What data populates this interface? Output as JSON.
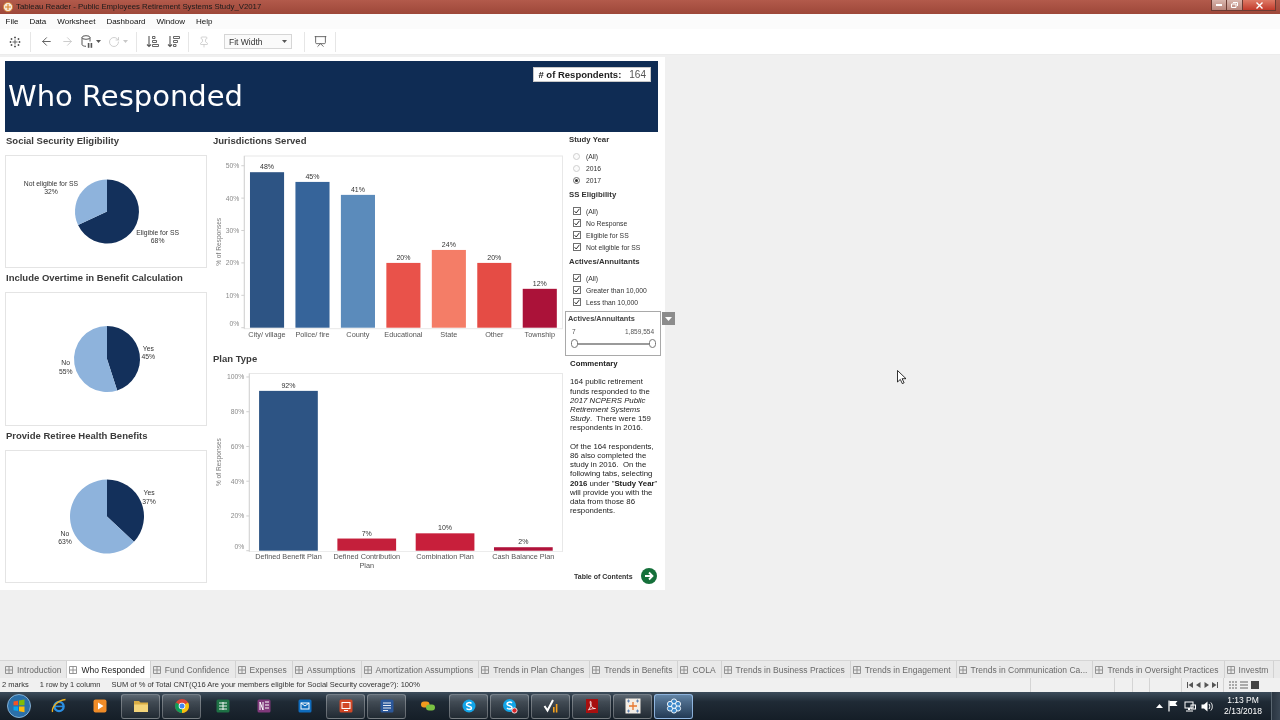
{
  "window": {
    "title": "Tableau Reader - Public Employees Retirement Systems Study_V2017"
  },
  "menu": [
    "File",
    "Data",
    "Worksheet",
    "Dashboard",
    "Window",
    "Help"
  ],
  "toolbar": {
    "groups": [
      {
        "items": [
          {
            "kind": "button",
            "disabled": false
          }
        ]
      },
      {
        "items": [
          {
            "kind": "button",
            "disabled": false
          },
          {
            "kind": "button",
            "disabled": true
          },
          {
            "kind": "button",
            "disabled": false
          },
          {
            "kind": "button",
            "disabled": true
          }
        ]
      },
      {
        "items": [
          {
            "kind": "button",
            "disabled": false
          },
          {
            "kind": "button",
            "disabled": false
          }
        ]
      },
      {
        "items": [
          {
            "kind": "button",
            "disabled": true
          },
          {
            "kind": "select",
            "value": "Fit Width"
          }
        ]
      },
      {
        "items": [
          {
            "kind": "button",
            "disabled": false
          }
        ]
      }
    ]
  },
  "dashboard": {
    "title": "Who Responded",
    "respondents": {
      "label": "# of Respondents:",
      "value": "164"
    },
    "pies": [
      {
        "title": "Social Security Eligibility",
        "chart_data": {
          "type": "pie",
          "categories": [
            "Eligible for SS",
            "Not eligible for SS"
          ],
          "values": [
            68,
            32
          ],
          "colors": [
            "#13305b",
            "#8eb3dc"
          ],
          "value_labels": [
            "68%",
            "32%"
          ]
        }
      },
      {
        "title": "Include Overtime in Benefit Calculation",
        "chart_data": {
          "type": "pie",
          "categories": [
            "Yes",
            "No"
          ],
          "values": [
            45,
            55
          ],
          "colors": [
            "#13305b",
            "#8eb3dc"
          ],
          "value_labels": [
            "45%",
            "55%"
          ]
        }
      },
      {
        "title": "Provide Retiree Health Benefits",
        "chart_data": {
          "type": "pie",
          "categories": [
            "Yes",
            "No"
          ],
          "values": [
            37,
            63
          ],
          "colors": [
            "#13305b",
            "#8eb3dc"
          ],
          "value_labels": [
            "37%",
            "63%"
          ]
        }
      }
    ],
    "jurisdictions": {
      "title": "Jurisdictions Served",
      "chart_data": {
        "type": "bar",
        "ylabel": "% of Responses",
        "categories": [
          "City/ village",
          "Police/ fire",
          "County",
          "Educational",
          "State",
          "Other",
          "Township"
        ],
        "values": [
          48,
          45,
          41,
          20,
          24,
          20,
          12
        ],
        "colors": [
          "#2d5484",
          "#36649a",
          "#5b8bbb",
          "#e9524a",
          "#f47d67",
          "#e54c45",
          "#ab1239"
        ],
        "ylim": [
          0,
          53
        ],
        "yticks": [
          {
            "value": 0,
            "label": "0%"
          },
          {
            "value": 10,
            "label": "10%"
          },
          {
            "value": 20,
            "label": "20%"
          },
          {
            "value": 30,
            "label": "30%"
          },
          {
            "value": 40,
            "label": "40%"
          },
          {
            "value": 50,
            "label": "50%"
          }
        ],
        "value_labels": [
          "48%",
          "45%",
          "41%",
          "20%",
          "24%",
          "20%",
          "12%"
        ]
      }
    },
    "plan_type": {
      "title": "Plan Type",
      "chart_data": {
        "type": "bar",
        "ylabel": "% of Responses",
        "categories": [
          "Defined Benefit Plan",
          "Defined Contribution Plan",
          "Combination Plan",
          "Cash Balance Plan"
        ],
        "values": [
          92,
          7,
          10,
          2
        ],
        "colors": [
          "#2d5484",
          "#c41f3b",
          "#c81f3b",
          "#b0123a"
        ],
        "ylim": [
          0,
          102
        ],
        "yticks": [
          {
            "value": 0,
            "label": "0%"
          },
          {
            "value": 20,
            "label": "20%"
          },
          {
            "value": 40,
            "label": "40%"
          },
          {
            "value": 60,
            "label": "60%"
          },
          {
            "value": 80,
            "label": "80%"
          },
          {
            "value": 100,
            "label": "100%"
          }
        ],
        "value_labels": [
          "92%",
          "7%",
          "10%",
          "2%"
        ]
      }
    },
    "filters": [
      {
        "kind": "radio",
        "title": "Study Year",
        "options": [
          {
            "label": "(All)",
            "selected": false
          },
          {
            "label": "2016",
            "selected": false
          },
          {
            "label": "2017",
            "selected": true
          }
        ]
      },
      {
        "kind": "checkbox",
        "title": "SS Eligibility",
        "options": [
          {
            "label": "(All)",
            "checked": true
          },
          {
            "label": "No Response",
            "checked": true
          },
          {
            "label": "Eligible for SS",
            "checked": true
          },
          {
            "label": "Not eligible for SS",
            "checked": true
          }
        ]
      },
      {
        "kind": "checkbox",
        "title": "Actives/Annuitants",
        "options": [
          {
            "label": "(All)",
            "checked": true
          },
          {
            "label": "Greater than 10,000",
            "checked": true
          },
          {
            "label": "Less than 10,000",
            "checked": true
          }
        ]
      },
      {
        "kind": "range",
        "title": "Actives/Annuitants",
        "min_label": "7",
        "max_label": "1,859,554",
        "handles": [
          {
            "level": 0
          },
          {
            "level": 1
          }
        ]
      }
    ],
    "commentary": {
      "title": "Commentary",
      "paragraphs": [
        "164 public retirement funds responded to the *2017 NCPERS Public Retirement Systems Study*.  There were 159 respondents in 2016.",
        "Of the 164 respondents, 86 also completed the study in 2016.  On the following tabs, selecting **2016** under \"**Study Year**\" will provide you with the data from those 86 respondents."
      ]
    },
    "toc_link": {
      "label": "Table of Contents"
    }
  },
  "sheet_tabs": [
    {
      "label": "Introduction",
      "selected": false
    },
    {
      "label": "Who Responded",
      "selected": true
    },
    {
      "label": "Fund Confidence",
      "selected": false
    },
    {
      "label": "Expenses",
      "selected": false
    },
    {
      "label": "Assumptions",
      "selected": false
    },
    {
      "label": "Amortization Assumptions",
      "selected": false
    },
    {
      "label": "Trends in Plan Changes",
      "selected": false
    },
    {
      "label": "Trends in Benefits",
      "selected": false
    },
    {
      "label": "COLA",
      "selected": false
    },
    {
      "label": "Trends in Business Practices",
      "selected": false
    },
    {
      "label": "Trends in Engagement",
      "selected": false
    },
    {
      "label": "Trends in Communication Ca...",
      "selected": false
    },
    {
      "label": "Trends in Oversight Practices",
      "selected": false
    },
    {
      "label": "Investm",
      "selected": false
    }
  ],
  "status_bar": {
    "items": [
      "2 marks",
      "1 row by 1 column",
      "SUM of % of Total CNT(Q16 Are your members eligible for Social Security coverage?): 100%"
    ]
  },
  "taskbar": {
    "apps": [
      {
        "running": false,
        "selected": false
      },
      {
        "running": false,
        "selected": false
      },
      {
        "running": true,
        "selected": false
      },
      {
        "running": true,
        "selected": false
      },
      {
        "running": false,
        "selected": false
      },
      {
        "running": false,
        "selected": false
      },
      {
        "running": false,
        "selected": false
      },
      {
        "running": true,
        "selected": false
      },
      {
        "running": true,
        "selected": false
      },
      {
        "running": false,
        "selected": false
      },
      {
        "running": true,
        "selected": false
      },
      {
        "running": true,
        "selected": false
      },
      {
        "running": true,
        "selected": false
      },
      {
        "running": true,
        "selected": false
      },
      {
        "running": true,
        "selected": false
      },
      {
        "running": true,
        "selected": true
      }
    ],
    "clock": {
      "time": "1:13 PM",
      "date": "2/13/2018"
    }
  }
}
